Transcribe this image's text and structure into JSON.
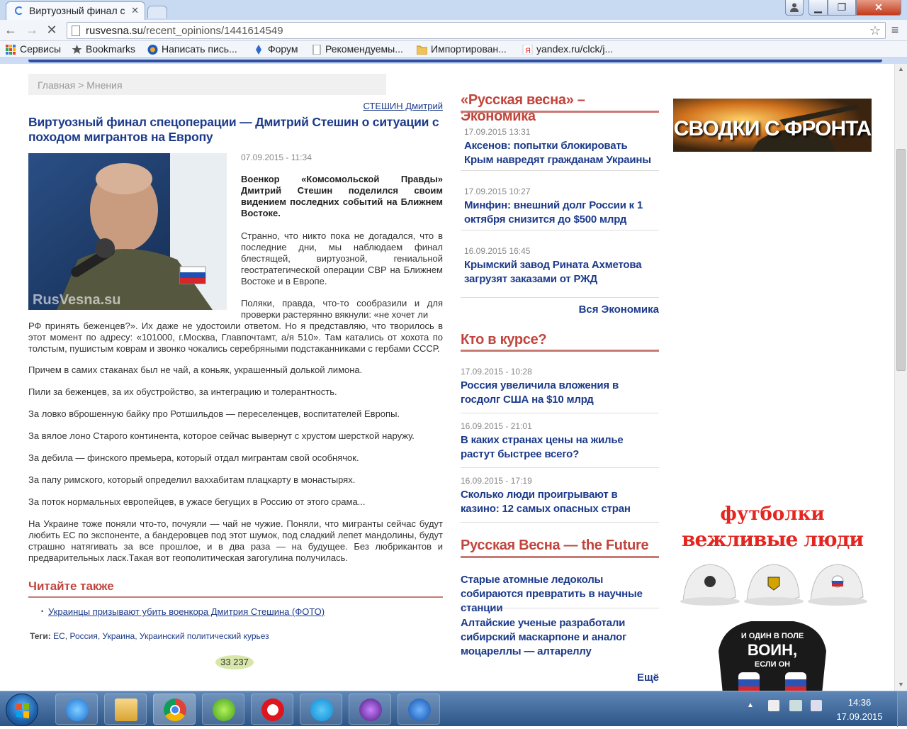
{
  "browser": {
    "tab_title": "Виртуозный финал с",
    "url_host": "rusvesna.su",
    "url_path": "/recent_opinions/1441614549",
    "bookmarks": [
      {
        "label": "Сервисы",
        "icon": "apps-grid-icon"
      },
      {
        "label": "Bookmarks",
        "icon": "bookmark-star-icon"
      },
      {
        "label": "Написать пись...",
        "icon": "mail-icon"
      },
      {
        "label": "Форум",
        "icon": "forum-icon"
      },
      {
        "label": "Рекомендуемы...",
        "icon": "page-icon"
      },
      {
        "label": "Импортирован...",
        "icon": "folder-icon"
      },
      {
        "label": "yandex.ru/clck/j...",
        "icon": "yandex-icon"
      }
    ]
  },
  "breadcrumb": "Главная > Мнения",
  "article": {
    "author": "СТЕШИН Дмитрий",
    "title": "Виртуозный финал спецоперации — Дмитрий Стешин о ситуации с походом мигрантов на Европу",
    "date": "07.09.2015 - 11:34",
    "photo_watermark": "RusVesna.su",
    "lead": "Военкор «Комсомольской Правды» Дмитрий Стешин поделился своим видением последних событий на Ближнем Востоке.",
    "p1": "Странно, что никто пока не догадался, что в последние дни, мы наблюдаем финал блестящей, виртуозной, гениальной геостратегической операции СВР на Ближнем Востоке и в Европе.",
    "p2a": "Поляки, правда, что-то сообразили и для проверки растерянно вякнули: «не хочет ли",
    "p2b": "РФ принять беженцев?». Их даже не удостоили ответом. Но я представляю, что творилось в этот момент по адресу: «101000, г.Москва, Главпочтамт, а/я 510». Там катались от хохота по толстым, пушистым коврам и звонко чокались серебряными подстаканниками с гербами СССР.",
    "p3": "Причем в самих стаканах был не чай, а коньяк, украшенный долькой лимона.",
    "p4": "Пили за беженцев, за их обустройство, за интеграцию и толерантность.",
    "p5": "За ловко вброшенную байку про Ротшильдов — переселенцев, воспитателей Европы.",
    "p6": "За вялое лоно Старого континента, которое сейчас вывернут с хрустом шерсткой наружу.",
    "p7": "За дебила — финского премьера, который отдал мигрантам свой особнячок.",
    "p8": "За папу римского, который определил ваххабитам плацкарту в монастырях.",
    "p9": "За поток нормальных европейцев, в ужасе бегущих в Россию от этого срама...",
    "p10": "На Украине тоже поняли что-то, почуяли — чай не чужие. Поняли, что мигранты сейчас будут любить ЕС по экспоненте, а бандеровцев под этот шумок, под сладкий лепет мандолины, будут страшно натягивать за все прошлое, и в два раза — на будущее. Без любрикантов и предварительных ласк.Такая вот геополитическая загогулина получилась.",
    "see_also_title": "Читайте также",
    "see_also_link": "Украинцы призывают убить военкора Дмитрия Стешина (ФОТО)",
    "tags_label": "Теги:",
    "tags": [
      "ЕС",
      "Россия",
      "Украина",
      "Украинский политический курьез"
    ],
    "views": "33 237"
  },
  "economy": {
    "heading": "«Русская весна» – Экономика",
    "items": [
      {
        "date": "17.09.2015 13:31",
        "title": "Аксенов: попытки блокировать Крым навредят гражданам Украины"
      },
      {
        "date": "17.09.2015 10:27",
        "title": "Минфин: внешний долг России к 1 октября снизится до $500 млрд"
      },
      {
        "date": "16.09.2015 16:45",
        "title": "Крымский завод Рината Ахметова загрузят заказами от РЖД"
      }
    ],
    "more": "Вся Экономика"
  },
  "aware": {
    "heading": "Кто в курсе?",
    "items": [
      {
        "date": "17.09.2015 - 10:28",
        "title": "Россия увеличила вложения в госдолг США на $10 млрд"
      },
      {
        "date": "16.09.2015 - 21:01",
        "title": "В каких странах цены на жилье растут быстрее всего?"
      },
      {
        "date": "16.09.2015 - 17:19",
        "title": "Сколько люди проигрывают в казино: 12 самых опасных стран"
      }
    ]
  },
  "future": {
    "heading": "Русская Весна — the Future",
    "items": [
      {
        "title": "Старые атомные ледоколы собираются превратить в научные станции"
      },
      {
        "title": "Алтайские ученые разработали сибирский маскарпоне и аналог моцареллы — алтареллу"
      }
    ],
    "more": "Ещё"
  },
  "banners": {
    "front": "СВОДКИ С ФРОНТА",
    "shirt_line1": "футболки",
    "shirt_line2": "вежливые люди",
    "shirt_text1": "И ОДИН В ПОЛЕ",
    "shirt_text2": "ВОИН,",
    "shirt_text3": "ЕСЛИ ОН"
  },
  "taskbar": {
    "time": "14:36",
    "date": "17.09.2015",
    "apps": [
      "internet-explorer-icon",
      "file-explorer-icon",
      "chrome-icon",
      "icq-icon",
      "opera-icon",
      "skype-icon",
      "spider-app-icon",
      "vpn-globe-icon"
    ]
  },
  "colors": {
    "accent_red": "#c1453c",
    "link_blue": "#1b3a8a",
    "top_rule": "#2f4ea0"
  }
}
